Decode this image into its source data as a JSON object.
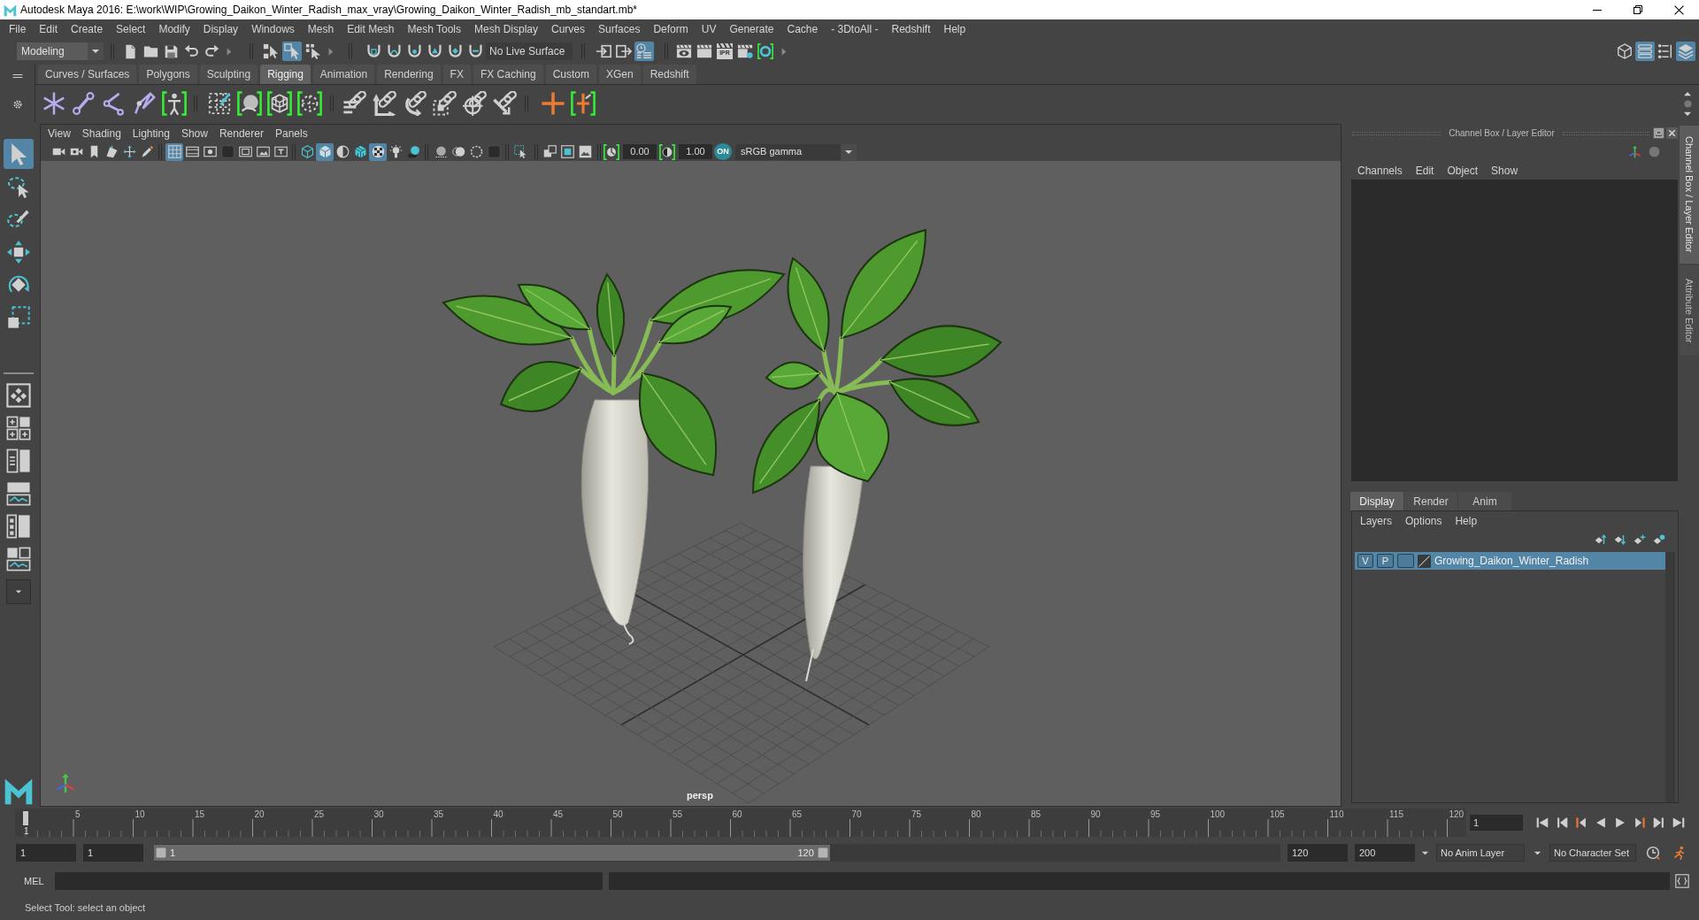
{
  "window": {
    "title": "Autodesk Maya 2016: E:\\work\\WIP\\Growing_Daikon_Winter_Radish_max_vray\\Growing_Daikon_Winter_Radish_mb_standart.mb*"
  },
  "menu_bar": [
    "File",
    "Edit",
    "Create",
    "Select",
    "Modify",
    "Display",
    "Windows",
    "Mesh",
    "Edit Mesh",
    "Mesh Tools",
    "Mesh Display",
    "Curves",
    "Surfaces",
    "Deform",
    "UV",
    "Generate",
    "Cache",
    "- 3DtoAll -",
    "Redshift",
    "Help"
  ],
  "status_line": {
    "menu_set": "Modeling",
    "select_modes": [
      {
        "selected": false
      },
      {
        "selected": true
      },
      {
        "selected": false
      }
    ],
    "live_surface": "No Live Surface",
    "history_buttons": [
      {
        "selected": false
      },
      {
        "selected": false
      },
      {
        "selected": true
      }
    ],
    "ipr_label": "IPR",
    "panel_toggles": [
      {
        "selected": false
      },
      {
        "selected": true
      },
      {
        "selected": false
      },
      {
        "selected": true
      }
    ]
  },
  "shelf": {
    "tabs": [
      {
        "label": "Curves / Surfaces",
        "selected": false
      },
      {
        "label": "Polygons",
        "selected": false
      },
      {
        "label": "Sculpting",
        "selected": false
      },
      {
        "label": "Rigging",
        "selected": true
      },
      {
        "label": "Animation",
        "selected": false
      },
      {
        "label": "Rendering",
        "selected": false
      },
      {
        "label": "FX",
        "selected": false
      },
      {
        "label": "FX Caching",
        "selected": false
      },
      {
        "label": "Custom",
        "selected": false
      },
      {
        "label": "XGen",
        "selected": false
      },
      {
        "label": "Redshift",
        "selected": false
      }
    ]
  },
  "toolbox": {
    "tools": [
      {
        "selected": true
      },
      {
        "selected": false
      },
      {
        "selected": false
      },
      {
        "selected": false
      },
      {
        "selected": false
      },
      {
        "selected": false
      }
    ]
  },
  "viewport": {
    "menus": [
      "View",
      "Shading",
      "Lighting",
      "Show",
      "Renderer",
      "Panels"
    ],
    "display_toggles": [
      {
        "selected": true
      },
      {
        "selected": false
      },
      {
        "selected": false
      },
      {
        "selected": false
      },
      {
        "selected": false
      },
      {
        "selected": false
      },
      {
        "selected": false
      }
    ],
    "shading_toggles": [
      {
        "selected": false
      },
      {
        "selected": true
      },
      {
        "selected": false
      },
      {
        "selected": false
      },
      {
        "selected": true
      },
      {
        "selected": false
      },
      {
        "selected": false
      }
    ],
    "exposure": "0.00",
    "gamma": "1.00",
    "color_management_label": "ON",
    "view_transform": "sRGB gamma",
    "camera": "persp"
  },
  "channel_box": {
    "title": "Channel Box / Layer Editor",
    "menus": [
      "Channels",
      "Edit",
      "Object",
      "Show"
    ]
  },
  "layer_editor": {
    "tabs": [
      {
        "label": "Display",
        "selected": true
      },
      {
        "label": "Render",
        "selected": false
      },
      {
        "label": "Anim",
        "selected": false
      }
    ],
    "menus": [
      "Layers",
      "Options",
      "Help"
    ],
    "layers": [
      {
        "v_label": "V",
        "p_label": "P",
        "name": "Growing_Daikon_Winter_Radish",
        "selected": true
      }
    ]
  },
  "side_tabs": [
    {
      "label": "Channel Box / Layer Editor",
      "selected": true
    },
    {
      "label": "Attribute Editor",
      "selected": false
    }
  ],
  "time_slider": {
    "ticks": [
      "5",
      "10",
      "15",
      "20",
      "25",
      "30",
      "35",
      "40",
      "45",
      "50",
      "55",
      "60",
      "65",
      "70",
      "75",
      "80",
      "85",
      "90",
      "95",
      "100",
      "105",
      "110",
      "115",
      "120"
    ],
    "level": 0,
    "current_label": "1",
    "current_frame": "1"
  },
  "range_slider": {
    "start_time": "1",
    "playback_start": "1",
    "level": 0.6,
    "range_start": "1",
    "range_end": "120",
    "playback_end": "120",
    "end_time": "200",
    "anim_layer": "No Anim Layer",
    "character_set": "No Character Set"
  },
  "command_line": {
    "label": "MEL"
  },
  "help_line": "Select Tool: select an object"
}
